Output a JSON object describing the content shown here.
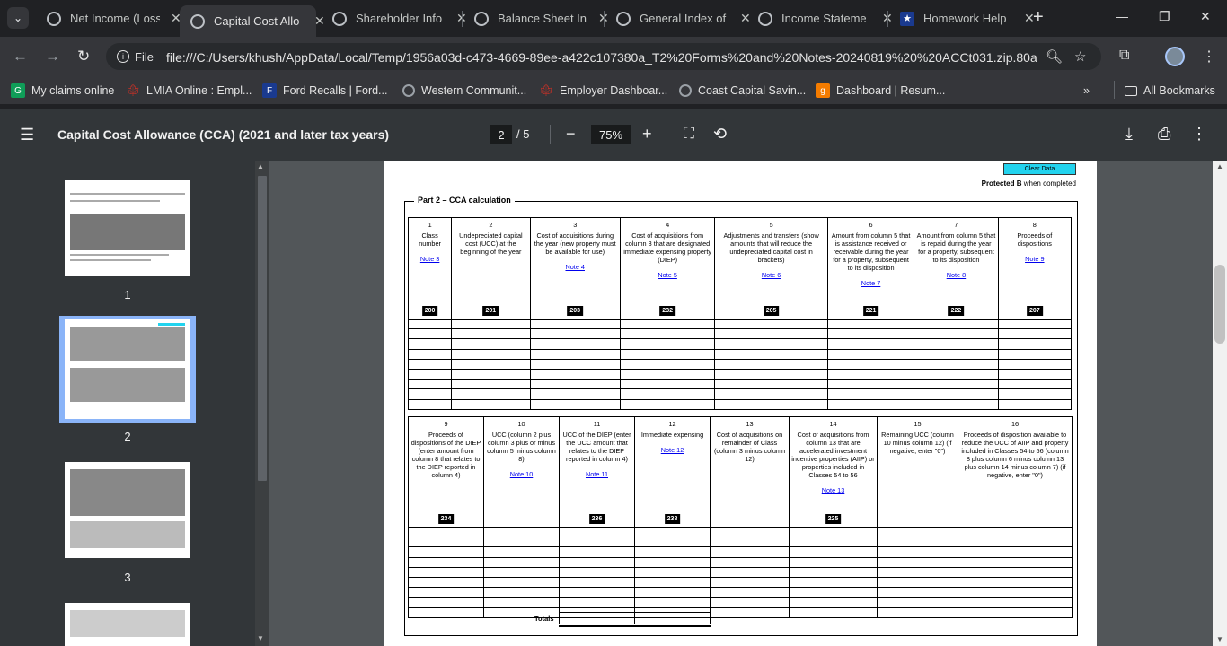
{
  "tabs": [
    {
      "title": "Net Income (Loss",
      "active": false
    },
    {
      "title": "Capital Cost Allo",
      "active": true
    },
    {
      "title": "Shareholder Info",
      "active": false
    },
    {
      "title": "Balance Sheet In",
      "active": false
    },
    {
      "title": "General Index of",
      "active": false
    },
    {
      "title": "Income Stateme",
      "active": false
    },
    {
      "title": "Homework Help",
      "active": false
    }
  ],
  "omnibox": {
    "chip_label": "File",
    "url": "file:///C:/Users/khush/AppData/Local/Temp/1956a03d-c473-4669-89ee-a422c107380a_T2%20Forms%20and%20Notes-20240819%20%20ACCt031.zip.80a/..."
  },
  "bookmarks": [
    {
      "label": "My claims online",
      "icon": "gckey-icon",
      "color": "#0f9d58"
    },
    {
      "label": "LMIA Online : Empl...",
      "icon": "maple-leaf-icon",
      "color": "#d93025"
    },
    {
      "label": "Ford Recalls | Ford...",
      "icon": "ford-icon",
      "color": "#1a3a8f"
    },
    {
      "label": "Western Communit...",
      "icon": "globe-icon",
      "color": "#9aa0a6"
    },
    {
      "label": "Employer Dashboar...",
      "icon": "maple-leaf-icon",
      "color": "#d93025"
    },
    {
      "label": "Coast Capital Savin...",
      "icon": "globe-icon",
      "color": "#9aa0a6"
    },
    {
      "label": "Dashboard | Resum...",
      "icon": "g-icon",
      "color": "#f57c00"
    }
  ],
  "all_bookmarks_label": "All Bookmarks",
  "pdf": {
    "title": "Capital Cost Allowance (CCA)  (2021 and later tax years)",
    "current_page": "2",
    "page_total": "/  5",
    "zoom": "75%"
  },
  "thumbnails": [
    "1",
    "2",
    "3"
  ],
  "form": {
    "clear_label": "Clear Data",
    "protected_b": "Protected B",
    "protected_suffix": " when completed",
    "part_title": "Part 2 – CCA calculation",
    "totals_label": "Totals",
    "table1": [
      {
        "num": "1",
        "text": "Class number",
        "note": "Note 3",
        "code": "200"
      },
      {
        "num": "2",
        "text": "Undepreciated capital cost (UCC) at the beginning of the year",
        "note": "",
        "code": "201"
      },
      {
        "num": "3",
        "text": "Cost of acquisitions during the year (new property must be available for use)",
        "note": "Note 4",
        "code": "203"
      },
      {
        "num": "4",
        "text": "Cost of acquisitions from column 3 that are designated immediate expensing property (DIEP)",
        "note": "Note 5",
        "code": "232"
      },
      {
        "num": "5",
        "text": "Adjustments and transfers (show amounts that will reduce the undepreciated capital cost in brackets)",
        "note": "Note 6",
        "code": "205"
      },
      {
        "num": "6",
        "text": "Amount from column 5 that is assistance received or receivable during the year for a property, subsequent to its disposition",
        "note": "Note 7",
        "code": "221"
      },
      {
        "num": "7",
        "text": "Amount from column 5 that is repaid during the year for a property, subsequent to its disposition",
        "note": "Note 8",
        "code": "222"
      },
      {
        "num": "8",
        "text": "Proceeds of dispositions",
        "note": "Note 9",
        "code": "207"
      }
    ],
    "table2": [
      {
        "num": "9",
        "text": "Proceeds of dispositions of the DIEP (enter amount from column 8 that relates to the DIEP reported in column 4)",
        "note": "",
        "code": "234"
      },
      {
        "num": "10",
        "text": "UCC (column 2 plus column 3 plus or minus column 5 minus column 8)",
        "note": "Note 10",
        "code": ""
      },
      {
        "num": "11",
        "text": "UCC of the DIEP (enter the UCC amount that relates to the DIEP reported in column 4)",
        "note": "Note 11",
        "code": "236"
      },
      {
        "num": "12",
        "text": "Immediate expensing",
        "note": "Note 12",
        "code": "238"
      },
      {
        "num": "13",
        "text": "Cost of acquisitions on remainder of Class (column 3 minus column 12)",
        "note": "",
        "code": ""
      },
      {
        "num": "14",
        "text": "Cost of acquisitions from column 13 that are accelerated investment incentive properties (AIIP) or properties included in Classes 54 to 56",
        "note": "Note 13",
        "code": "225"
      },
      {
        "num": "15",
        "text": "Remaining UCC (column 10 minus column 12) (if negative, enter \"0\")",
        "note": "",
        "code": ""
      },
      {
        "num": "16",
        "text": "Proceeds of disposition available to reduce the UCC of AIIP and property included in Classes 54 to 56 (column 8 plus column 6 minus column 13 plus column 14 minus column 7) (if negative, enter \"0\")",
        "note": "",
        "code": ""
      }
    ]
  }
}
